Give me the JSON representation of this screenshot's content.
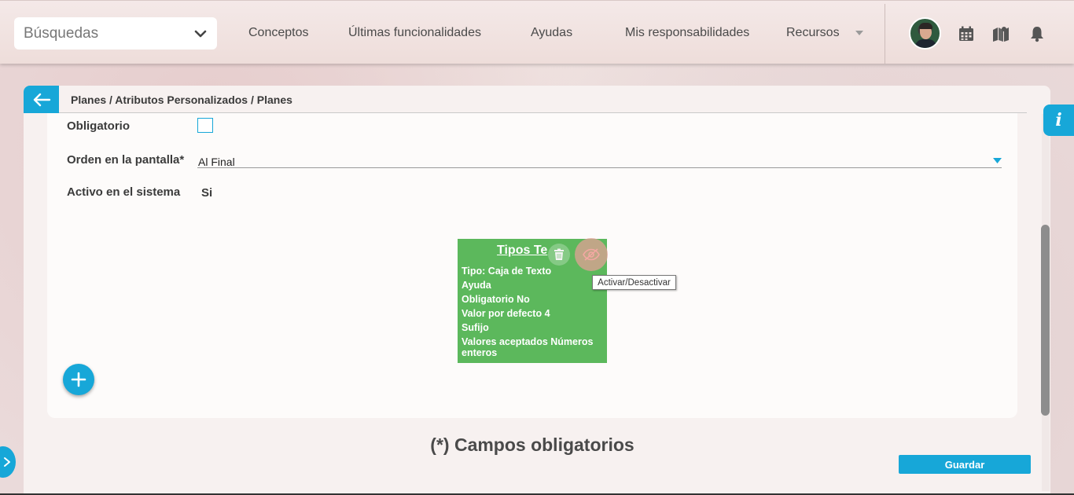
{
  "header": {
    "search_label": "Búsquedas",
    "nav": [
      {
        "label": "Conceptos"
      },
      {
        "label": "Últimas funcionalidades"
      },
      {
        "label": "Ayudas"
      },
      {
        "label": "Mis responsabilidades"
      },
      {
        "label": "Recursos"
      }
    ],
    "icons": [
      "calendar-icon",
      "map-icon",
      "bell-icon"
    ]
  },
  "breadcrumb": "Planes / Atributos Personalizados / Planes",
  "form": {
    "obligatorio_label": "Obligatorio",
    "obligatorio_checked": false,
    "orden_label": "Orden en la pantalla*",
    "orden_value": "Al Final",
    "activo_label": "Activo en el sistema",
    "activo_value": "Si"
  },
  "attribute_card": {
    "title": "Tipos Te",
    "lines": [
      "Tipo: Caja de Texto",
      "Ayuda",
      "Obligatorio No",
      "Valor por defecto 4",
      "Sufijo",
      "Valores aceptados Números",
      "enteros"
    ],
    "tooltip": "Activar/Desactivar"
  },
  "footer": {
    "required_note": "(*) Campos obligatorios",
    "save_label": "Guardar"
  },
  "info_label": "i",
  "colors": {
    "accent": "#17a7d8",
    "card_green": "#5cb85c"
  }
}
